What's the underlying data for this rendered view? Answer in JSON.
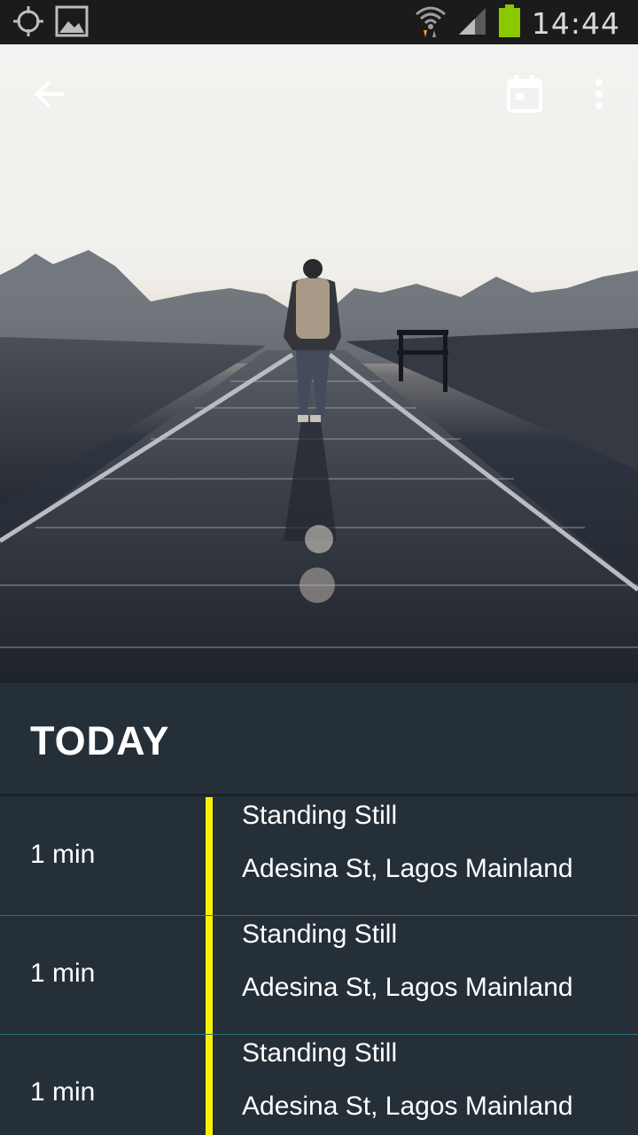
{
  "status_bar": {
    "time": "14:44",
    "icons": [
      "gps-icon",
      "image-icon",
      "wifi-icon",
      "signal-icon",
      "battery-icon"
    ],
    "battery_color": "#8cc800"
  },
  "toolbar": {
    "back_icon": "arrow-back-icon",
    "calendar_icon": "calendar-icon",
    "more_icon": "more-vert-icon"
  },
  "section": {
    "title": "TODAY"
  },
  "timeline_color": "#f7f300",
  "activities": [
    {
      "duration": "1 min",
      "status": "Standing Still",
      "location": "Adesina St, Lagos Mainland"
    },
    {
      "duration": "1 min",
      "status": "Standing Still",
      "location": "Adesina St, Lagos Mainland"
    },
    {
      "duration": "1 min",
      "status": "Standing Still",
      "location": "Adesina St, Lagos Mainland"
    }
  ]
}
